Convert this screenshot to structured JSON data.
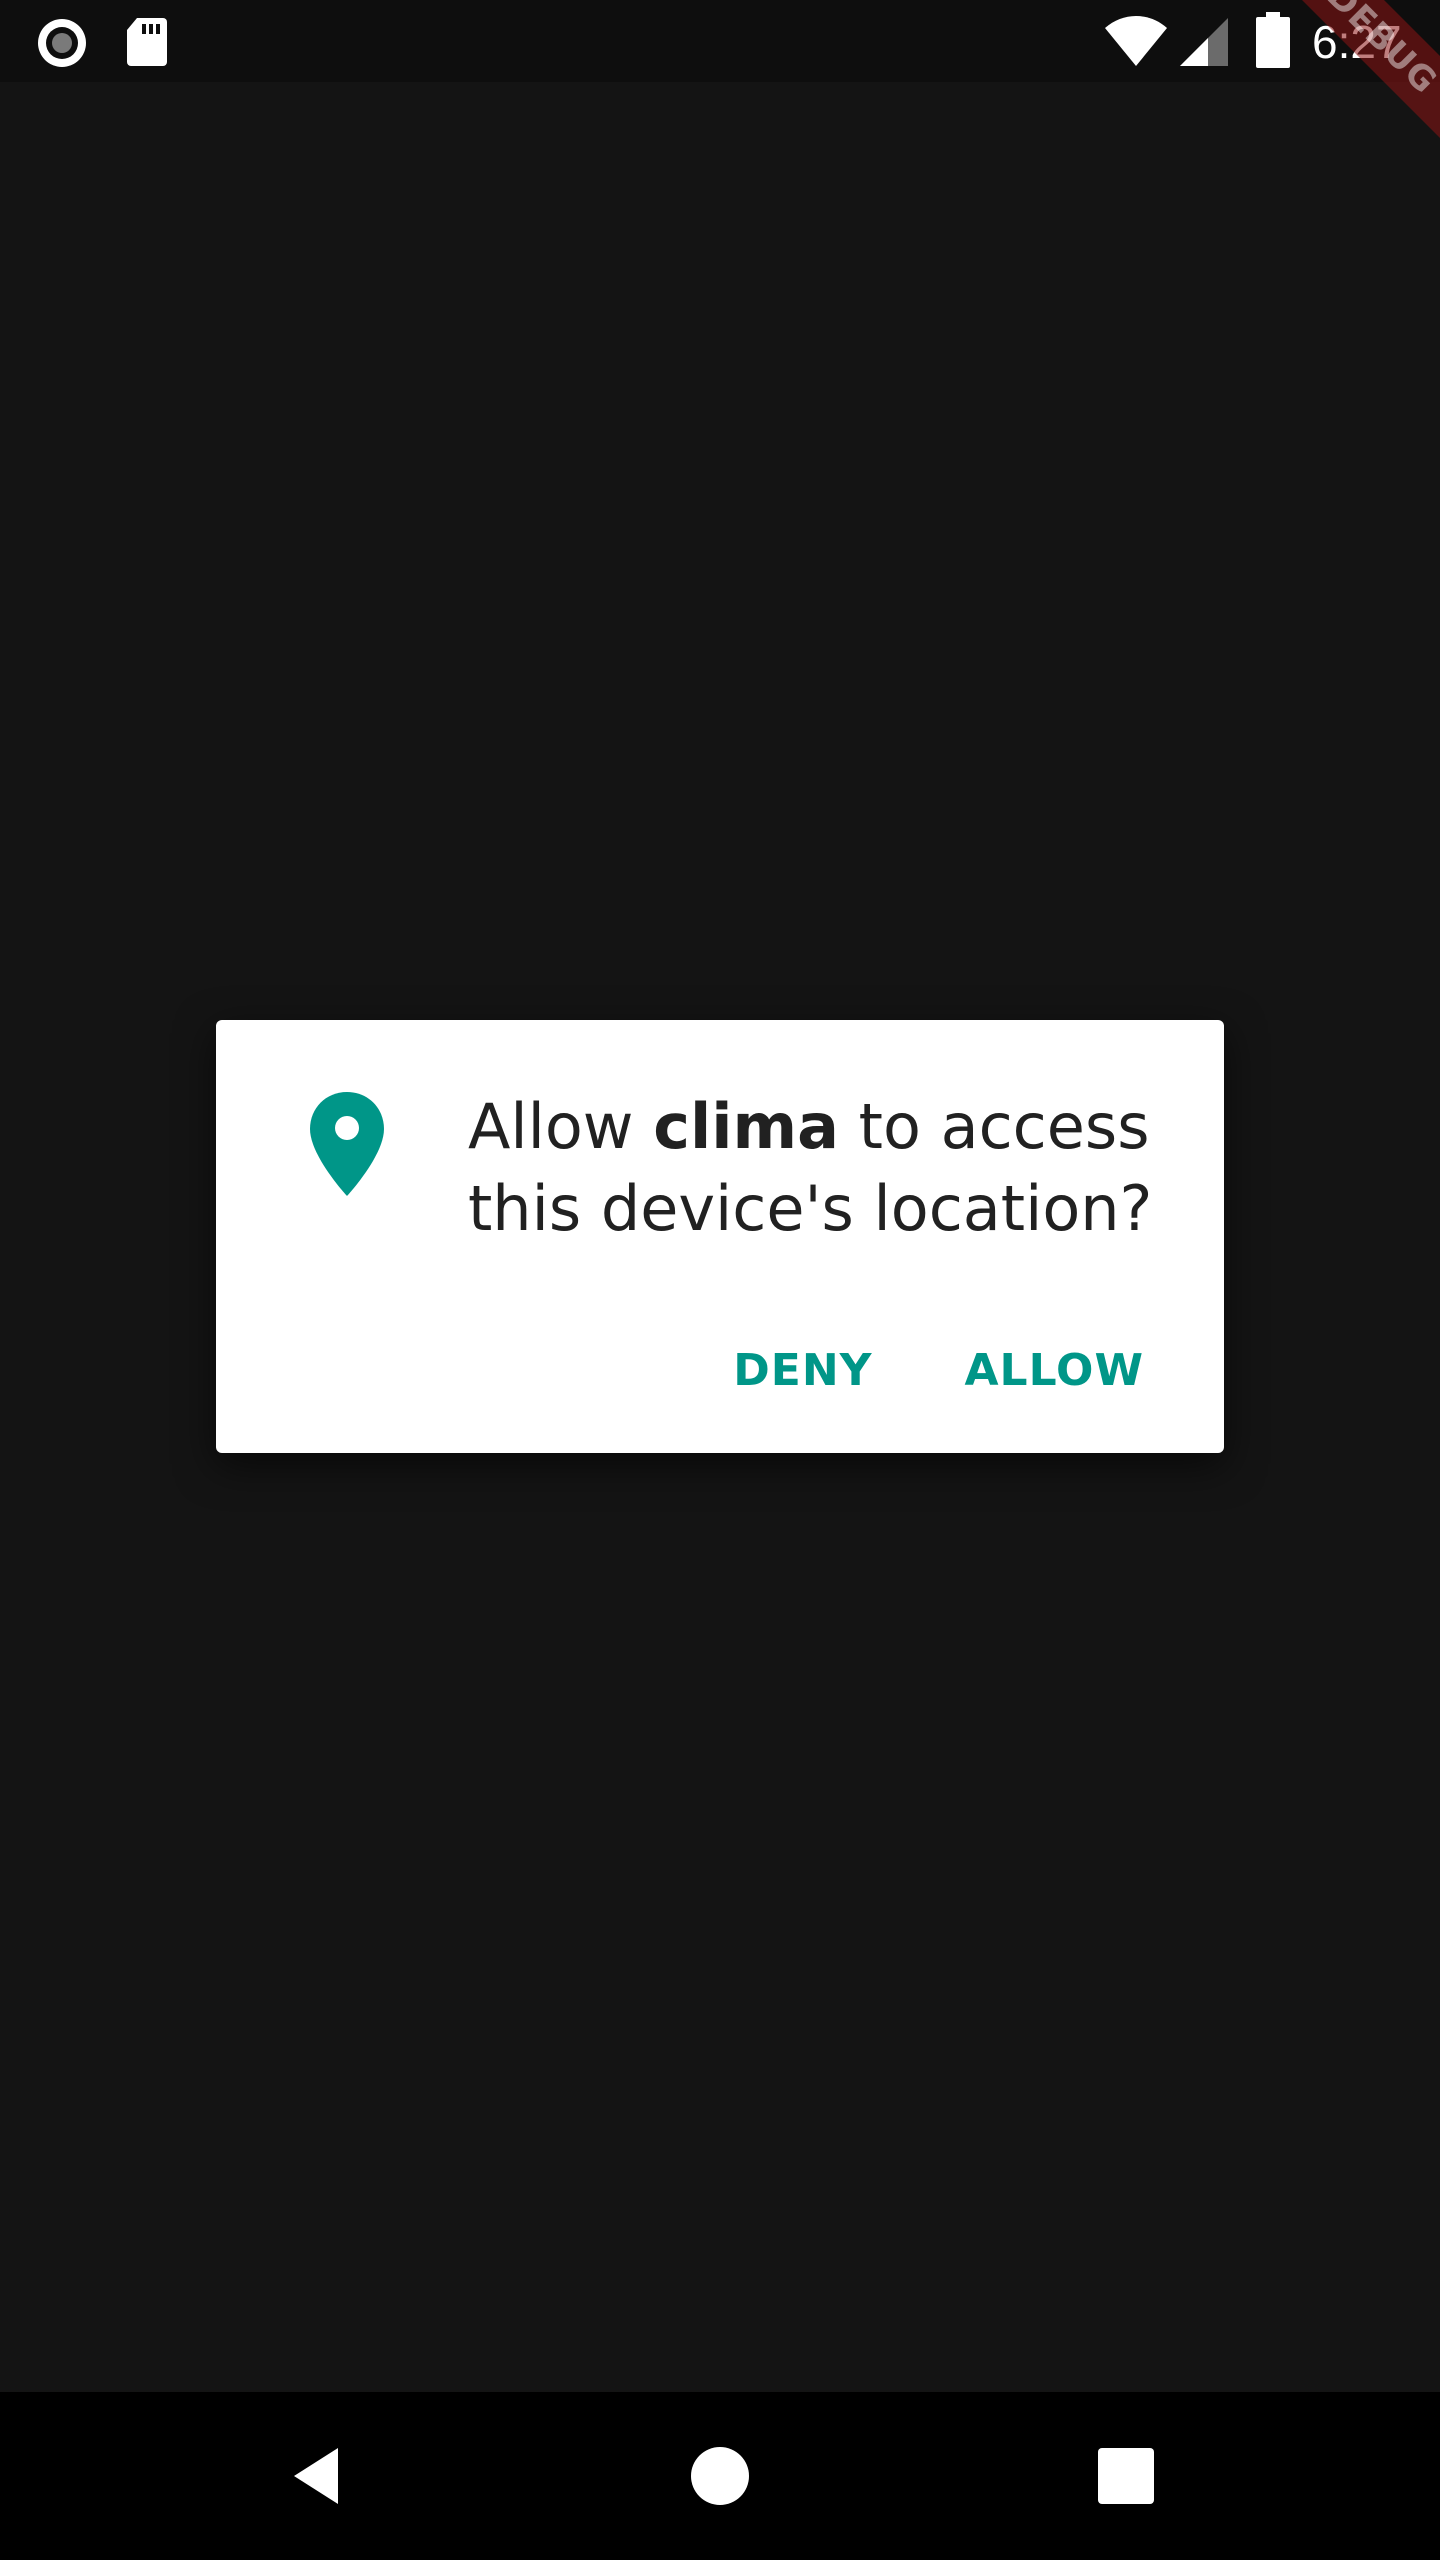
{
  "status_bar": {
    "time": "6:27",
    "left_icons": [
      "record-icon",
      "sd-card-icon"
    ],
    "right_icons": [
      "wifi-icon",
      "cell-signal-icon",
      "battery-icon"
    ]
  },
  "debug_banner": {
    "label": "DEBUG",
    "color": "#8c1414"
  },
  "dialog": {
    "icon": "location-pin-icon",
    "message_prefix": "Allow ",
    "app_name": "clima",
    "message_suffix_line1": " to access",
    "message_line2": "this device's location?",
    "deny_label": "DENY",
    "allow_label": "ALLOW",
    "accent_color": "#009688"
  },
  "nav_bar": {
    "buttons": [
      "back-icon",
      "home-icon",
      "recents-icon"
    ]
  }
}
